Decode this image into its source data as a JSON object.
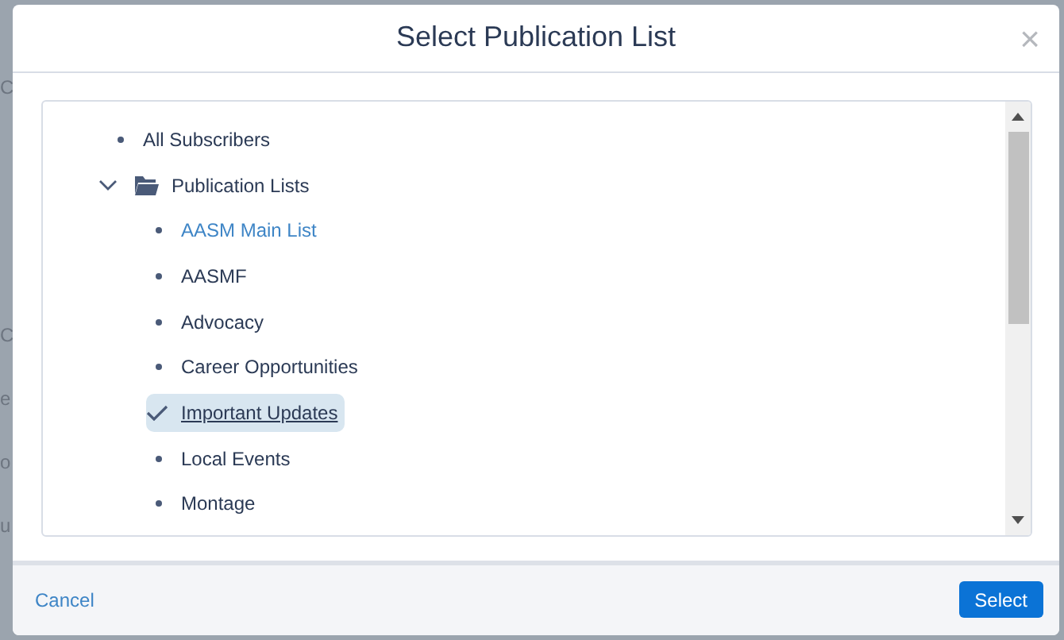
{
  "background": {
    "texts": [
      "C",
      "C",
      "e",
      "o",
      "u"
    ]
  },
  "dialog": {
    "title": "Select Publication List",
    "close": "×",
    "tree": [
      {
        "kind": "leaf",
        "label": "All Subscribers",
        "selected": false,
        "hovered": false
      },
      {
        "kind": "folder",
        "label": "Publication Lists",
        "expanded": true,
        "selected": false,
        "hovered": false,
        "children": [
          {
            "kind": "leaf",
            "label": "AASM Main List",
            "selected": false,
            "hovered": true
          },
          {
            "kind": "leaf",
            "label": "AASMF",
            "selected": false,
            "hovered": false
          },
          {
            "kind": "leaf",
            "label": "Advocacy",
            "selected": false,
            "hovered": false
          },
          {
            "kind": "leaf",
            "label": "Career Opportunities",
            "selected": false,
            "hovered": false
          },
          {
            "kind": "leaf",
            "label": "Important Updates",
            "selected": true,
            "hovered": false
          },
          {
            "kind": "leaf",
            "label": "Local Events",
            "selected": false,
            "hovered": false
          },
          {
            "kind": "leaf",
            "label": "Montage",
            "selected": false,
            "hovered": false
          }
        ]
      }
    ],
    "cancel": "Cancel",
    "select": "Select"
  }
}
